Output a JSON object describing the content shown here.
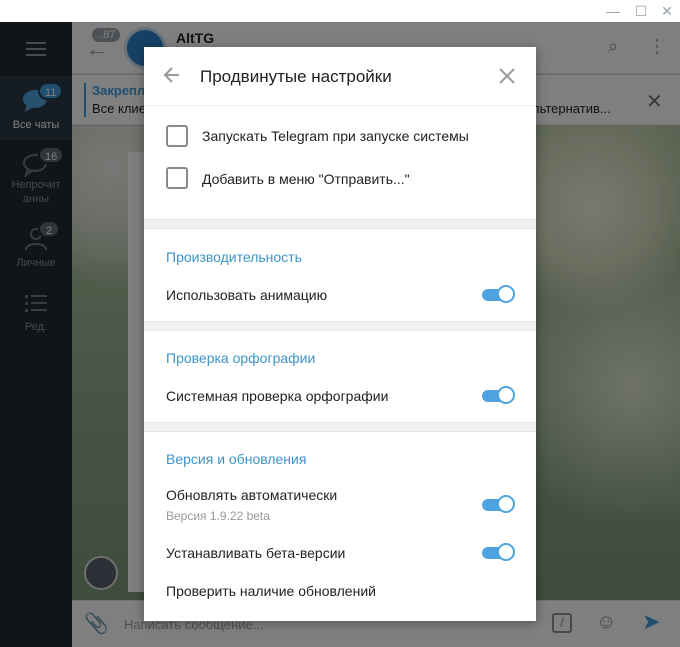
{
  "sidebar": {
    "folders": [
      {
        "label": "Все чаты",
        "badge": "11",
        "active": true
      },
      {
        "label": "Непрочитанные",
        "badge": "16",
        "active": false
      },
      {
        "label": "Личные",
        "badge": "2",
        "active": false
      },
      {
        "label": "Ред.",
        "badge": "",
        "active": false
      }
    ],
    "folder1_line1": "Непрочит",
    "folder1_line2": "анны"
  },
  "chat": {
    "title": "AltTG",
    "back_unread": "87",
    "pinned_title": "Закрепл",
    "pinned_text": "Все клие",
    "pinned_text_right": "льтернатив...",
    "composer_placeholder": "Написать сообщение...",
    "command_glyph": "/"
  },
  "dialog": {
    "title": "Продвинутые настройки",
    "checkboxes": [
      {
        "label": "Запускать Telegram при запуске системы",
        "checked": false
      },
      {
        "label": "Добавить в меню \"Отправить...\"",
        "checked": false
      }
    ],
    "sections": {
      "performance": {
        "title": "Производительность",
        "animation_label": "Использовать анимацию",
        "animation_on": true
      },
      "spellcheck": {
        "title": "Проверка орфографии",
        "system_label": "Системная проверка орфографии",
        "system_on": true
      },
      "updates": {
        "title": "Версия и обновления",
        "auto_label": "Обновлять автоматически",
        "version": "Версия 1.9.22 beta",
        "auto_on": true,
        "beta_label": "Устанавливать бета-версии",
        "beta_on": true,
        "check_label": "Проверить наличие обновлений"
      }
    }
  },
  "colors": {
    "accent": "#3e93c9",
    "toggle": "#4ea3df",
    "sidebar_bg": "#1f2a33"
  }
}
